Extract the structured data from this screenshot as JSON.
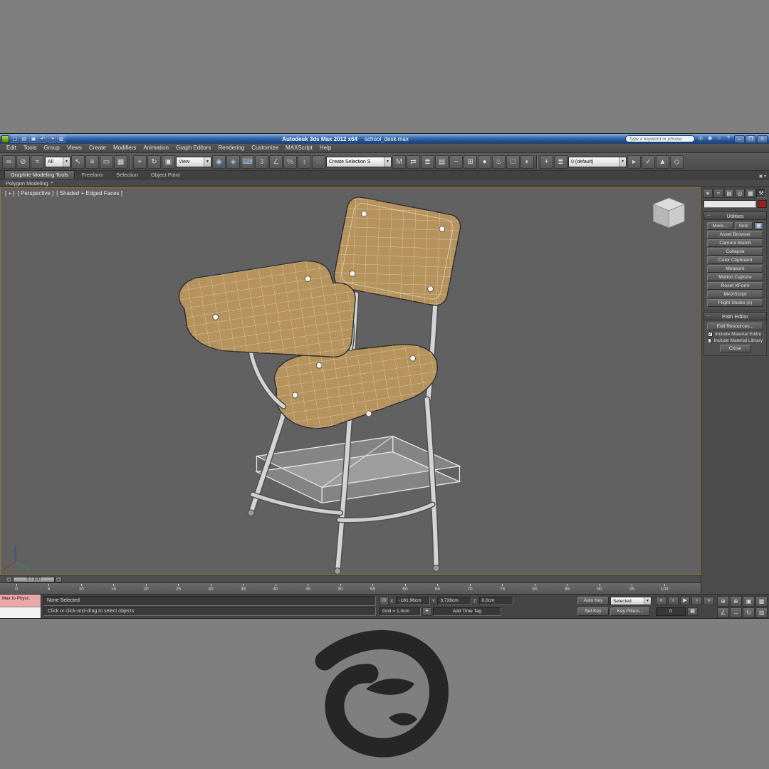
{
  "colors": {
    "desktop_gray": "#7f7f7f",
    "titlebar_blue": "#2a5592",
    "viewport_background": "#616161",
    "wood": "#b6925c",
    "frame_metal": "#d2d2d2",
    "close_red": "#a12c22",
    "color_swatch_red": "#9e1f1f",
    "listener_pink": "#e9a7a7",
    "logo_dark": "#262626"
  },
  "window": {
    "title": "Autodesk 3ds Max 2012 x64",
    "document": "school_desk.max",
    "search_placeholder": "Type a keyword or phrase",
    "quick_access": [
      {
        "name": "new-scene-icon",
        "glyph": "▢"
      },
      {
        "name": "open-file-icon",
        "glyph": "▤"
      },
      {
        "name": "save-file-icon",
        "glyph": "▣"
      },
      {
        "name": "undo-icon",
        "glyph": "↶"
      },
      {
        "name": "redo-icon",
        "glyph": "↷"
      },
      {
        "name": "project-folder-icon",
        "glyph": "▥"
      }
    ],
    "info_icons": [
      {
        "name": "search-go-icon",
        "glyph": "◎"
      },
      {
        "name": "communication-center-icon",
        "glyph": "◉"
      },
      {
        "name": "favorites-star-icon",
        "glyph": "☆"
      },
      {
        "name": "help-icon",
        "glyph": "?"
      }
    ],
    "window_buttons": [
      {
        "name": "minimize-button",
        "glyph": "–"
      },
      {
        "name": "restore-button",
        "glyph": "❐"
      },
      {
        "name": "close-button",
        "glyph": "×"
      }
    ]
  },
  "menu": {
    "items": [
      "Edit",
      "Tools",
      "Group",
      "Views",
      "Create",
      "Modifiers",
      "Animation",
      "Graph Editors",
      "Rendering",
      "Customize",
      "MAXScript",
      "Help"
    ]
  },
  "toolbar": {
    "left_icons": [
      {
        "name": "select-and-link-icon",
        "glyph": "∞"
      },
      {
        "name": "unlink-selection-icon",
        "glyph": "⊘"
      },
      {
        "name": "bind-to-space-warp-icon",
        "glyph": "≈"
      }
    ],
    "selection_filter_value": "All",
    "select_icons": [
      {
        "name": "select-object-icon",
        "glyph": "↖"
      },
      {
        "name": "select-by-name-icon",
        "glyph": "≡"
      },
      {
        "name": "selection-region-icon",
        "glyph": "▭"
      },
      {
        "name": "window-crossing-icon",
        "glyph": "▦"
      }
    ],
    "transform_icons": [
      {
        "name": "select-and-move-icon",
        "glyph": "+"
      },
      {
        "name": "select-and-rotate-icon",
        "glyph": "↻"
      },
      {
        "name": "select-and-scale-icon",
        "glyph": "▣"
      }
    ],
    "ref_coord_value": "View",
    "mid_icons": [
      {
        "name": "use-pivot-center-icon",
        "glyph": "◉"
      },
      {
        "name": "select-and-manipulate-icon",
        "glyph": "◈"
      },
      {
        "name": "keyboard-override-icon",
        "glyph": "⌨"
      },
      {
        "name": "snap-toggle-3d-icon",
        "glyph": "3"
      },
      {
        "name": "angle-snap-icon",
        "glyph": "∠"
      },
      {
        "name": "percent-snap-icon",
        "glyph": "%"
      },
      {
        "name": "spinner-snap-icon",
        "glyph": "↕"
      },
      {
        "name": "edit-named-sets-icon",
        "glyph": "∷"
      }
    ],
    "named_sets_value": "Create Selection S",
    "right_icons": [
      {
        "name": "mirror-icon",
        "glyph": "M"
      },
      {
        "name": "align-icon",
        "glyph": "⇄"
      },
      {
        "name": "layer-manager-icon",
        "glyph": "≣"
      },
      {
        "name": "ribbon-toggle-icon",
        "glyph": "▤"
      },
      {
        "name": "curve-editor-icon",
        "glyph": "~"
      },
      {
        "name": "schematic-view-icon",
        "glyph": "⊞"
      },
      {
        "name": "material-editor-icon",
        "glyph": "●"
      },
      {
        "name": "render-setup-icon",
        "glyph": "♨"
      },
      {
        "name": "rendered-frame-icon",
        "glyph": "□"
      },
      {
        "name": "render-production-icon",
        "glyph": "◐"
      }
    ],
    "layer_icons_pre": [
      {
        "name": "create-layer-icon",
        "glyph": "+"
      },
      {
        "name": "layer-list-icon",
        "glyph": "≣"
      }
    ],
    "layer_value": "0 (default)",
    "layer_icons_post": [
      {
        "name": "select-objects-in-layer-icon",
        "glyph": "▸"
      },
      {
        "name": "set-current-layer-icon",
        "glyph": "✓"
      },
      {
        "name": "graphite-tools-icon",
        "glyph": "▲"
      },
      {
        "name": "isolate-selection-icon",
        "glyph": "◇"
      }
    ]
  },
  "ribbon": {
    "tabs": [
      "Graphite Modeling Tools",
      "Freeform",
      "Selection",
      "Object Paint"
    ],
    "mini_glyph": "▣ ▾",
    "panel_label": "Polygon Modeling",
    "collapse_glyph": "▾"
  },
  "viewport": {
    "label_segments": [
      "[ + ]",
      "[ Perspective ]",
      "[ Shaded + Edged Faces ]"
    ]
  },
  "command_panel": {
    "tabs": [
      {
        "name": "create-tab",
        "glyph": "∗"
      },
      {
        "name": "modify-tab",
        "glyph": "≈"
      },
      {
        "name": "hierarchy-tab",
        "glyph": "▤"
      },
      {
        "name": "motion-tab",
        "glyph": "◎"
      },
      {
        "name": "display-tab",
        "glyph": "▦"
      },
      {
        "name": "utilities-tab",
        "glyph": "⚒"
      }
    ],
    "utilities": {
      "header": "Utilities",
      "more_button": "More...",
      "sets_button": "Sets",
      "configure_glyph": "▦",
      "buttons": [
        "Asset Browser",
        "Camera Match",
        "Collapse",
        "Color Clipboard",
        "Measure",
        "Motion Capture",
        "Reset XForm",
        "MAXScript",
        "Flight Studio (c)"
      ]
    },
    "path_editor": {
      "header": "Path Editor",
      "edit_resources_button": "Edit Resources...",
      "checkboxes": [
        {
          "label": "Include Material Editor",
          "checked": true
        },
        {
          "label": "Include Material Library",
          "checked": false
        }
      ],
      "close_button": "Close"
    }
  },
  "timeline": {
    "slider_label": "0 / 100",
    "arrow_left": "◂",
    "arrow_right": "▸",
    "ticks": [
      "0",
      "5",
      "10",
      "15",
      "20",
      "25",
      "30",
      "35",
      "40",
      "45",
      "50",
      "55",
      "60",
      "65",
      "70",
      "75",
      "80",
      "85",
      "90",
      "95",
      "100"
    ]
  },
  "status_bar": {
    "mini_listener_text": "Max to Physc.",
    "status_text": "None Selected",
    "prompt_text": "Click or click-and-drag to select objects",
    "lock_glyph": "⊙",
    "x_label": "X:",
    "x_value": "-181,96cm",
    "y_label": "Y:",
    "y_value": "3,728cm",
    "z_label": "Z:",
    "z_value": "0,0cm",
    "grid_text": "Grid = 1,0cm",
    "time_tag_glyph": "✦",
    "add_time_tag": "Add Time Tag",
    "auto_key_label": "Auto Key",
    "set_key_label": "Set Key",
    "key_mode_value": "Selected",
    "key_filters_label": "Key Filters...",
    "frame_value": "0",
    "time_config_glyph": "▦",
    "transport": [
      {
        "name": "go-to-start-button",
        "glyph": "«"
      },
      {
        "name": "previous-frame-button",
        "glyph": "‹"
      },
      {
        "name": "play-button",
        "glyph": "▶"
      },
      {
        "name": "next-frame-button",
        "glyph": "›"
      },
      {
        "name": "go-to-end-button",
        "glyph": "»"
      }
    ],
    "nav_buttons": [
      {
        "name": "zoom-icon",
        "glyph": "⊕"
      },
      {
        "name": "zoom-all-icon",
        "glyph": "⊕"
      },
      {
        "name": "zoom-extents-icon",
        "glyph": "▣"
      },
      {
        "name": "zoom-extents-all-icon",
        "glyph": "▩"
      },
      {
        "name": "field-of-view-icon",
        "glyph": "∠"
      },
      {
        "name": "pan-icon",
        "glyph": "↔"
      },
      {
        "name": "orbit-icon",
        "glyph": "↻"
      },
      {
        "name": "maximize-viewport-icon",
        "glyph": "▥"
      }
    ]
  }
}
